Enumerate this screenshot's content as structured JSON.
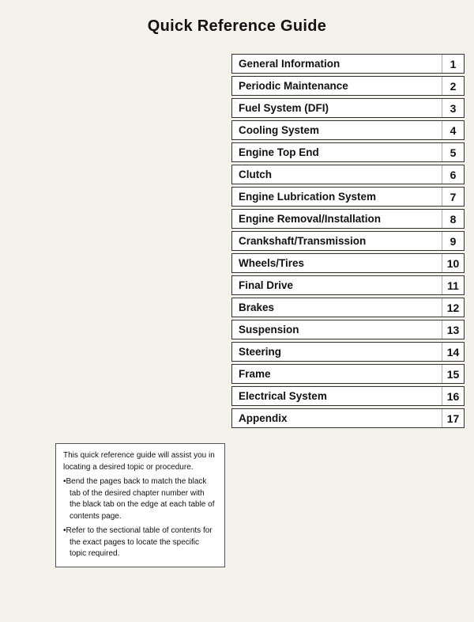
{
  "page": {
    "title": "Quick Reference Guide",
    "toc": [
      {
        "label": "General Information",
        "number": "1"
      },
      {
        "label": "Periodic Maintenance",
        "number": "2"
      },
      {
        "label": "Fuel System (DFI)",
        "number": "3"
      },
      {
        "label": "Cooling System",
        "number": "4"
      },
      {
        "label": "Engine Top End",
        "number": "5"
      },
      {
        "label": "Clutch",
        "number": "6"
      },
      {
        "label": "Engine Lubrication System",
        "number": "7"
      },
      {
        "label": "Engine Removal/Installation",
        "number": "8"
      },
      {
        "label": "Crankshaft/Transmission",
        "number": "9"
      },
      {
        "label": "Wheels/Tires",
        "number": "10"
      },
      {
        "label": "Final Drive",
        "number": "11"
      },
      {
        "label": "Brakes",
        "number": "12"
      },
      {
        "label": "Suspension",
        "number": "13"
      },
      {
        "label": "Steering",
        "number": "14"
      },
      {
        "label": "Frame",
        "number": "15"
      },
      {
        "label": "Electrical System",
        "number": "16"
      },
      {
        "label": "Appendix",
        "number": "17"
      }
    ],
    "note": {
      "intro": "This quick reference guide will assist you in locating a desired topic or procedure.",
      "bullets": [
        "Bend the pages back to match the black tab of the desired chapter number with the black tab on the edge at each table of contents page.",
        "Refer to the sectional table of contents for the exact pages to locate the specific topic required."
      ]
    }
  }
}
